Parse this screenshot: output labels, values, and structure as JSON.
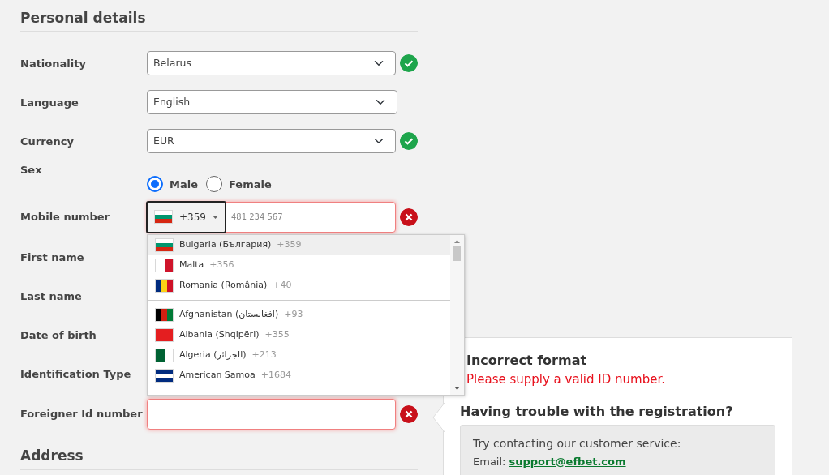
{
  "heading": "Personal details",
  "fields": [
    {
      "label": "Nationality",
      "kind": "select",
      "value": "Belarus",
      "valid": true
    },
    {
      "label": "Language",
      "kind": "select",
      "value": "English"
    },
    {
      "label": "Currency",
      "kind": "select",
      "value": "EUR",
      "valid": true
    },
    {
      "label": "Sex",
      "kind": "radio",
      "options": [
        {
          "label": "Male",
          "selected": true
        },
        {
          "label": "Female",
          "selected": false
        }
      ]
    },
    {
      "label": "Mobile number",
      "kind": "phone",
      "code": "+359",
      "placeholder": "481 234 567",
      "valid": false,
      "flag": {
        "kind": "horizontal",
        "stripes": [
          {
            "color": "#ffffff"
          },
          {
            "color": "#00966e"
          },
          {
            "color": "#d62612"
          }
        ]
      }
    },
    {
      "label": "First name"
    },
    {
      "label": "Last name"
    },
    {
      "label": "Date of birth"
    },
    {
      "label": "Identification Type"
    },
    {
      "label": "Foreigner Id number",
      "kind": "text",
      "valid": false
    }
  ],
  "country_dropdown": {
    "preferred": [
      {
        "name": "Bulgaria (България)",
        "code": "+359",
        "selected": true,
        "flag": {
          "kind": "horizontal",
          "stripes": [
            {
              "color": "#ffffff"
            },
            {
              "color": "#00966e"
            },
            {
              "color": "#d62612"
            }
          ]
        }
      },
      {
        "name": "Malta",
        "code": "+356",
        "selected": false,
        "flag": {
          "kind": "vertical",
          "stripes": [
            {
              "color": "#ffffff"
            },
            {
              "color": "#cf142b"
            }
          ]
        }
      },
      {
        "name": "Romania (România)",
        "code": "+40",
        "selected": false,
        "flag": {
          "kind": "vertical",
          "stripes": [
            {
              "color": "#002b7f"
            },
            {
              "color": "#fcd116"
            },
            {
              "color": "#ce1126"
            }
          ]
        }
      }
    ],
    "countries": [
      {
        "name": "Afghanistan (افغانستان)",
        "code": "+93",
        "selected": false,
        "flag": {
          "kind": "vertical",
          "stripes": [
            {
              "color": "#000000"
            },
            {
              "color": "#d32011"
            },
            {
              "color": "#007a36"
            }
          ]
        }
      },
      {
        "name": "Albania (Shqipëri)",
        "code": "+355",
        "selected": false,
        "flag": {
          "kind": "vertical",
          "stripes": [
            {
              "color": "#e41e20"
            }
          ]
        }
      },
      {
        "name": "Algeria (الجزائر)",
        "code": "+213",
        "selected": false,
        "flag": {
          "kind": "vertical",
          "stripes": [
            {
              "color": "#006233"
            },
            {
              "color": "#ffffff"
            }
          ]
        }
      },
      {
        "name": "American Samoa",
        "code": "+1684",
        "selected": false,
        "flag": {
          "kind": "horizontal",
          "stripes": [
            {
              "color": "#002b7f"
            },
            {
              "color": "#ffffff"
            },
            {
              "color": "#002b7f"
            }
          ]
        }
      }
    ]
  },
  "error": {
    "title": "Incorrect format",
    "message": "Please supply a valid ID number."
  },
  "help": {
    "title": "Having trouble with the registration?",
    "text": "Try contacting our customer service:",
    "email_label": "Email:",
    "email": "support@efbet.com"
  },
  "address_heading": "Address"
}
